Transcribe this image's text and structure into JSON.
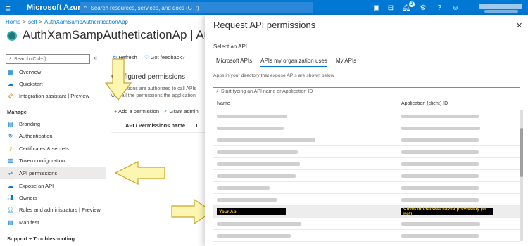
{
  "topbar": {
    "brand": "Microsoft Azure",
    "search_placeholder": "Search resources, services, and docs (G+/)",
    "notification_count": "2",
    "bg_color": "#0078d4"
  },
  "breadcrumb": {
    "items": [
      "Home",
      "self",
      "AuthXamSampAuthenticationApp"
    ]
  },
  "app_title": "AuthXamSampAutheticationAp | Authentica",
  "sidebar": {
    "search_placeholder": "Search (Ctrl+/)",
    "collapse_label": "«",
    "items_top": [
      {
        "label": "Overview",
        "icon": "overview-icon"
      },
      {
        "label": "Quickstart",
        "icon": "quickstart-icon"
      },
      {
        "label": "Integration assistant | Preview",
        "icon": "rocket-icon"
      }
    ],
    "manage_heading": "Manage",
    "manage_items": [
      {
        "label": "Branding",
        "icon": "branding-icon"
      },
      {
        "label": "Authentication",
        "icon": "authentication-icon"
      },
      {
        "label": "Certificates & secrets",
        "icon": "key-icon"
      },
      {
        "label": "Token configuration",
        "icon": "token-icon"
      },
      {
        "label": "API permissions",
        "icon": "api-icon",
        "active": true
      },
      {
        "label": "Expose an API",
        "icon": "cloud-icon"
      },
      {
        "label": "Owners",
        "icon": "owners-icon"
      },
      {
        "label": "Roles and administrators | Preview",
        "icon": "roles-icon"
      },
      {
        "label": "Manifest",
        "icon": "manifest-icon"
      }
    ],
    "support_heading": "Support + Troubleshooting"
  },
  "middle": {
    "refresh": "Refresh",
    "feedback": "Got feedback?",
    "configured_title": "Configured permissions",
    "description": "Applications are authorized to call APIs whe all the permissions the application needs. L",
    "add_permission": "Add a permission",
    "grant_admin": "Grant admin",
    "col_api": "API / Permissions name",
    "col_t": "T"
  },
  "panel": {
    "title": "Request API permissions",
    "close": "✕",
    "select_label": "Select an API",
    "tabs": [
      "Microsoft APIs",
      "APIs my organization uses",
      "My APIs"
    ],
    "active_tab": 1,
    "note": "Apps in your directory that expose APIs are shown below",
    "search_placeholder": "Start typing an API name or Application ID",
    "col_name": "Name",
    "col_appid": "Application (client) ID",
    "highlight_name": "Your Api",
    "highlight_id": "Client id that was saved previously (or not)",
    "highlight_text_color": "#f0c419"
  },
  "colors": {
    "accent": "#0078d4",
    "arrow_fill": "#fdf6b0",
    "arrow_stroke": "#c8a62c"
  }
}
